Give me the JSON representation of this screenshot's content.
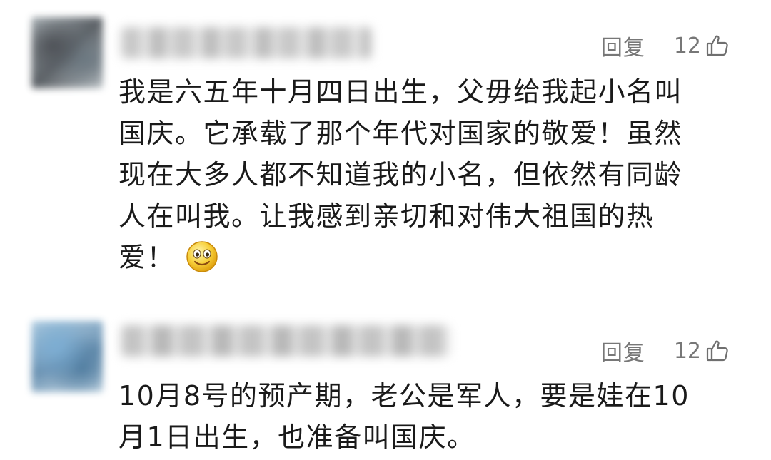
{
  "comments": [
    {
      "reply_label": "回复",
      "like_count": "12",
      "text": "我是六五年十月四日出生，父毋给我起小名叫\n国庆。它承载了那个年代对国家的敬爱！虽然\n现在大多人都不知道我的小名，但依然有同龄\n人在叫我。让我感到亲切和对伟大祖国的热\n爱！",
      "emoji": "smile-emoji"
    },
    {
      "reply_label": "回复",
      "like_count": "12",
      "text": "10月8号的预产期，老公是军人，要是娃在10\n月1日出生，也准备叫国庆。"
    }
  ],
  "colors": {
    "text": "#1a1a1a",
    "meta": "#777777",
    "background": "#ffffff"
  }
}
